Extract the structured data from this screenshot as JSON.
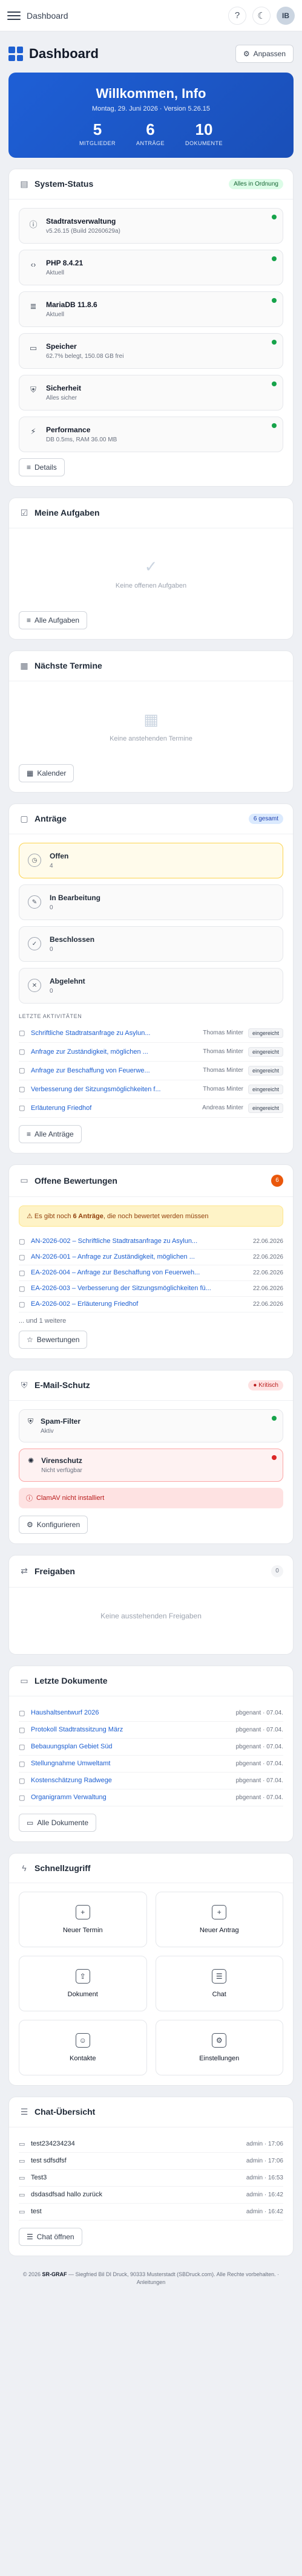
{
  "topbar": {
    "breadcrumb": "Dashboard",
    "user_initials": "IB"
  },
  "page": {
    "title": "Dashboard",
    "customize_label": "Anpassen"
  },
  "welcome": {
    "title": "Willkommen, Info",
    "subtitle": "Montag, 29. Juni 2026 · Version 5.26.15",
    "stats": [
      {
        "value": "5",
        "label": "MITGLIEDER"
      },
      {
        "value": "6",
        "label": "ANTRÄGE"
      },
      {
        "value": "10",
        "label": "DOKUMENTE"
      }
    ]
  },
  "system": {
    "title": "System-Status",
    "badge": "Alles in Ordnung",
    "details_label": "Details",
    "items": [
      {
        "name": "Stadtratsverwaltung",
        "desc": "v5.26.15 (Build 20260629a)",
        "icon": "info-icon",
        "status": "ok"
      },
      {
        "name": "PHP 8.4.21",
        "desc": "Aktuell",
        "icon": "code-icon",
        "status": "ok"
      },
      {
        "name": "MariaDB 11.8.6",
        "desc": "Aktuell",
        "icon": "database-icon",
        "status": "ok"
      },
      {
        "name": "Speicher",
        "desc": "62.7% belegt, 150.08 GB frei",
        "icon": "storage-icon",
        "status": "ok"
      },
      {
        "name": "Sicherheit",
        "desc": "Alles sicher",
        "icon": "shield-icon",
        "status": "ok"
      },
      {
        "name": "Performance",
        "desc": "DB 0.5ms, RAM 36.00 MB",
        "icon": "performance-icon",
        "status": "ok"
      }
    ]
  },
  "tasks": {
    "title": "Meine Aufgaben",
    "empty": "Keine offenen Aufgaben",
    "button": "Alle Aufgaben"
  },
  "events": {
    "title": "Nächste Termine",
    "empty": "Keine anstehenden Termine",
    "button": "Kalender"
  },
  "requests": {
    "title": "Anträge",
    "badge": "6 gesamt",
    "button": "Alle Anträge",
    "activity_label": "LETZTE AKTIVITÄTEN",
    "statuses": [
      {
        "name": "Offen",
        "count": "4",
        "icon": "clock-icon"
      },
      {
        "name": "In Bearbeitung",
        "count": "0",
        "icon": "edit-icon"
      },
      {
        "name": "Beschlossen",
        "count": "0",
        "icon": "check-icon"
      },
      {
        "name": "Abgelehnt",
        "count": "0",
        "icon": "x-icon"
      }
    ],
    "activities": [
      {
        "title": "Schriftliche Stadtratsanfrage zu Asylun...",
        "who": "Thomas Minter",
        "tag": "eingereicht"
      },
      {
        "title": "Anfrage zur Zuständigkeit, möglichen ...",
        "who": "Thomas Minter",
        "tag": "eingereicht"
      },
      {
        "title": "Anfrage zur Beschaffung von Feuerwe...",
        "who": "Thomas Minter",
        "tag": "eingereicht"
      },
      {
        "title": "Verbesserung der Sitzungsmöglichkeiten f...",
        "who": "Thomas Minter",
        "tag": "eingereicht"
      },
      {
        "title": "Erläuterung Friedhof",
        "who": "Andreas Minter",
        "tag": "eingereicht"
      }
    ]
  },
  "reviews": {
    "title": "Offene Bewertungen",
    "badge": "6",
    "warning_pre": "Es gibt noch",
    "warning_bold": "6 Anträge",
    "warning_post": ", die noch bewertet werden müssen",
    "more": "... und 1 weitere",
    "button": "Bewertungen",
    "items": [
      {
        "title": "AN-2026-002 – Schriftliche Stadtratsanfrage zu Asylun...",
        "date": "22.06.2026"
      },
      {
        "title": "AN-2026-001 – Anfrage zur Zuständigkeit, möglichen ...",
        "date": "22.06.2026"
      },
      {
        "title": "EA-2026-004 – Anfrage zur Beschaffung von Feuerweh...",
        "date": "22.06.2026"
      },
      {
        "title": "EA-2026-003 – Verbesserung der Sitzungsmöglichkeiten fü...",
        "date": "22.06.2026"
      },
      {
        "title": "EA-2026-002 – Erläuterung Friedhof",
        "date": "22.06.2026"
      }
    ]
  },
  "email": {
    "title": "E-Mail-Schutz",
    "badge": "Kritisch",
    "button": "Konfigurieren",
    "error": "ClamAV nicht installiert",
    "items": [
      {
        "name": "Spam-Filter",
        "desc": "Aktiv",
        "status": "ok",
        "icon": "shield-icon"
      },
      {
        "name": "Virenschutz",
        "desc": "Nicht verfügbar",
        "status": "bad",
        "icon": "virus-icon"
      }
    ]
  },
  "shares": {
    "title": "Freigaben",
    "badge": "0",
    "empty": "Keine ausstehenden Freigaben"
  },
  "documents": {
    "title": "Letzte Dokumente",
    "button": "Alle Dokumente",
    "items": [
      {
        "name": "Haushaltsentwurf 2026",
        "who": "pbgenant · 07.04."
      },
      {
        "name": "Protokoll Stadtratssitzung März",
        "who": "pbgenant · 07.04."
      },
      {
        "name": "Bebauungsplan Gebiet Süd",
        "who": "pbgenant · 07.04."
      },
      {
        "name": "Stellungnahme Umweltamt",
        "who": "pbgenant · 07.04."
      },
      {
        "name": "Kostenschätzung Radwege",
        "who": "pbgenant · 07.04."
      },
      {
        "name": "Organigramm Verwaltung",
        "who": "pbgenant · 07.04."
      }
    ]
  },
  "quick": {
    "title": "Schnellzugriff",
    "items": [
      {
        "label": "Neuer Termin",
        "glyph": "+"
      },
      {
        "label": "Neuer Antrag",
        "glyph": "+"
      },
      {
        "label": "Dokument",
        "glyph": "⇪"
      },
      {
        "label": "Chat",
        "glyph": "☰"
      },
      {
        "label": "Kontakte",
        "glyph": "☺"
      },
      {
        "label": "Einstellungen",
        "glyph": "⚙"
      }
    ]
  },
  "chat": {
    "title": "Chat-Übersicht",
    "button": "Chat öffnen",
    "items": [
      {
        "msg": "test234234234",
        "who": "admin · 17:06"
      },
      {
        "msg": "test sdfsdfsf",
        "who": "admin · 17:06"
      },
      {
        "msg": "Test3",
        "who": "admin · 16:53"
      },
      {
        "msg": "dsdasdfsad hallo zurück",
        "who": "admin · 16:42"
      },
      {
        "msg": "test",
        "who": "admin · 16:42"
      }
    ]
  },
  "footer": {
    "text_pre": "© 2026",
    "brand": "SR-GRAF",
    "text_post": "— Siegfried Bil DI Druck, 90333 Musterstadt (SBDruck.com). Alle Rechte vorbehalten. · Anleitungen"
  },
  "colors": {
    "accent": "#1d5fd1",
    "ok": "#16a34a",
    "bad": "#dc2626",
    "warn": "#f59e0b"
  }
}
